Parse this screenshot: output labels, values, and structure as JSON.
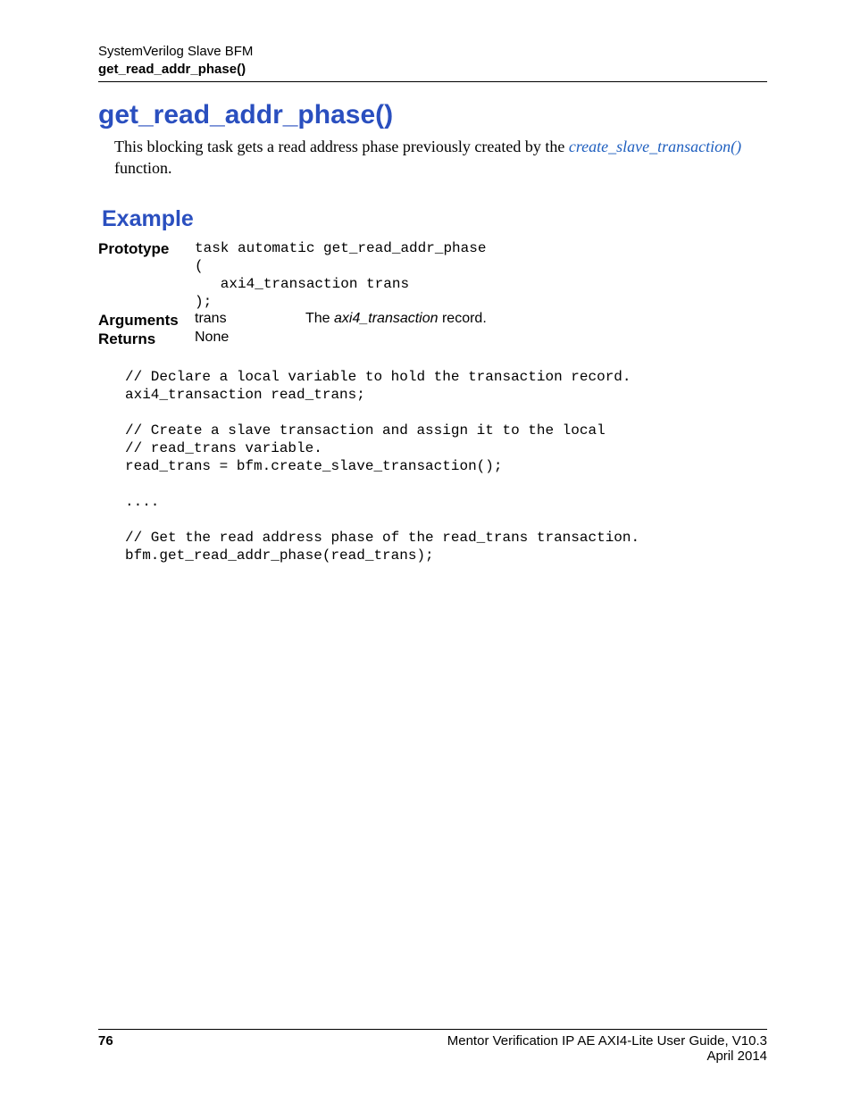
{
  "header": {
    "line1": "SystemVerilog Slave BFM",
    "line2": "get_read_addr_phase()"
  },
  "title": "get_read_addr_phase()",
  "intro": {
    "text_before": "This blocking task gets a read address phase previously created by the ",
    "link": "create_slave_transaction()",
    "text_after": " function."
  },
  "section_heading": "Example",
  "prototype": {
    "label": "Prototype",
    "code": "task automatic get_read_addr_phase\n(\n   axi4_transaction trans\n);"
  },
  "arguments": {
    "label": "Arguments",
    "name": "trans",
    "desc_prefix": "The ",
    "desc_ital": "axi4_transaction",
    "desc_suffix": " record."
  },
  "returns": {
    "label": "Returns",
    "value": "None"
  },
  "example_code": "// Declare a local variable to hold the transaction record.\naxi4_transaction read_trans;\n\n// Create a slave transaction and assign it to the local\n// read_trans variable.\nread_trans = bfm.create_slave_transaction();\n\n....\n\n// Get the read address phase of the read_trans transaction.\nbfm.get_read_addr_phase(read_trans);",
  "footer": {
    "page": "76",
    "title": "Mentor Verification IP AE AXI4-Lite User Guide, V10.3",
    "date": "April 2014"
  }
}
